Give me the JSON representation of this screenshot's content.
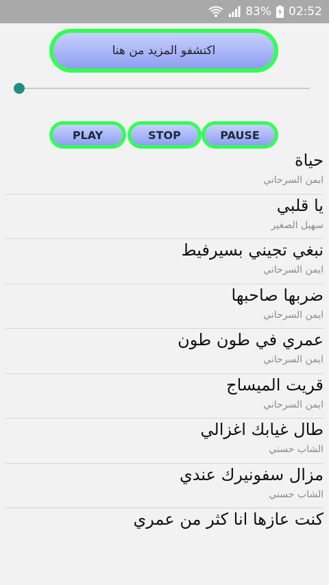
{
  "status": {
    "battery": "83%",
    "time": "02:52"
  },
  "header": {
    "more_button": "اكتشفو المزيد من هنا"
  },
  "controls": {
    "play": "PLAY",
    "stop": "STOP",
    "pause": "PAUSE"
  },
  "seek": {
    "position": 0
  },
  "songs": [
    {
      "title": "حياة",
      "artist": "ايمن السرحاني"
    },
    {
      "title": "يا قلبي",
      "artist": "سهيل الصغير"
    },
    {
      "title": "نبغي تجيني بسيرفيط",
      "artist": "ايمن السرحاني"
    },
    {
      "title": "ضربها صاحبها",
      "artist": "ايمن السرحاني"
    },
    {
      "title": "عمري في طون طون",
      "artist": "ايمن السرحاني"
    },
    {
      "title": "قريت الميساج",
      "artist": "ايمن السرحاني"
    },
    {
      "title": "طال غيابك اغزالي",
      "artist": "الشاب حسني"
    },
    {
      "title": "مزال سفونيرك عندي",
      "artist": "الشاب حسني"
    },
    {
      "title": "كنت عازها انا كثر من عمري",
      "artist": ""
    }
  ]
}
